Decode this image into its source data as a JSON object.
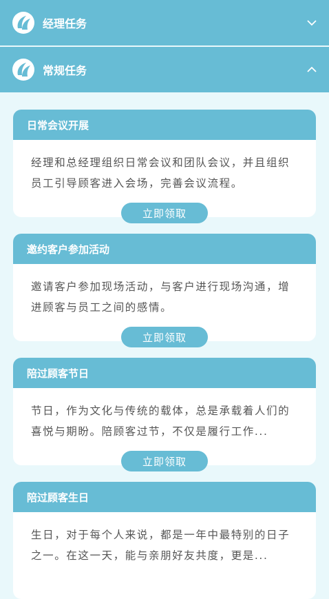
{
  "sections": [
    {
      "title": "经理任务",
      "expanded": false
    },
    {
      "title": "常规任务",
      "expanded": true
    }
  ],
  "tasks": [
    {
      "title": "日常会议开展",
      "desc": "经理和总经理组织日常会议和团队会议，并且组织员工引导顾客进入会场，完善会议流程。",
      "button": "立即领取"
    },
    {
      "title": "邀约客户参加活动",
      "desc": "邀请客户参加现场活动，与客户进行现场沟通，增进顾客与员工之间的感情。",
      "button": "立即领取"
    },
    {
      "title": "陪过顾客节日",
      "desc": "节日，作为文化与传统的载体，总是承载着人们的喜悦与期盼。陪顾客过节，不仅是履行工作...",
      "button": "立即领取"
    },
    {
      "title": "陪过顾客生日",
      "desc": "生日，对于每个人来说，都是一年中最特别的日子之一。在这一天，能与亲朋好友共度，更是...",
      "button": ""
    }
  ],
  "colors": {
    "accent": "#67bcd5",
    "background": "#e9f8fb"
  }
}
